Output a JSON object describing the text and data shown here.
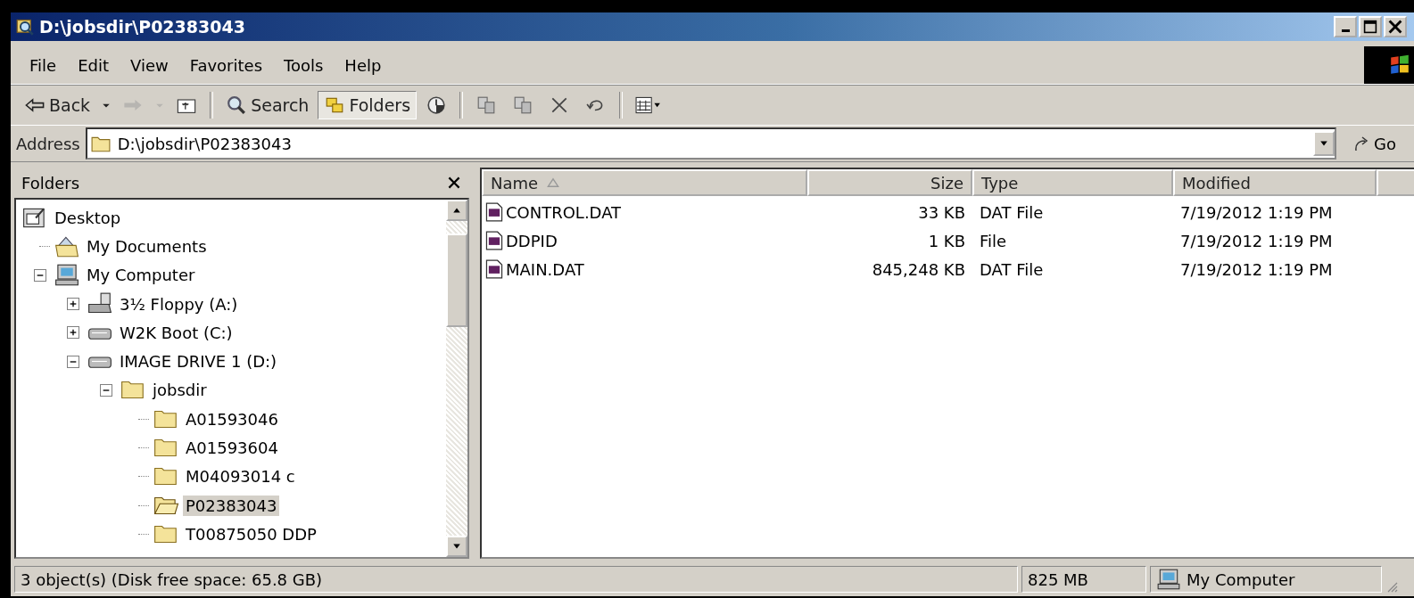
{
  "window": {
    "title": "D:\\jobsdir\\P02383043"
  },
  "menu": [
    "File",
    "Edit",
    "View",
    "Favorites",
    "Tools",
    "Help"
  ],
  "toolbar": [
    {
      "kind": "back",
      "label": "Back",
      "disabled": false,
      "on": false
    },
    {
      "kind": "dropdown",
      "disabled": false,
      "on": false
    },
    {
      "kind": "forward",
      "disabled": true,
      "on": false
    },
    {
      "kind": "dropdown",
      "disabled": true,
      "on": false
    },
    {
      "kind": "up",
      "disabled": false,
      "on": false
    },
    {
      "kind": "separator"
    },
    {
      "kind": "search",
      "label": "Search",
      "disabled": false,
      "on": false
    },
    {
      "kind": "folders",
      "label": "Folders",
      "disabled": false,
      "on": true
    },
    {
      "kind": "history",
      "disabled": false,
      "on": false
    },
    {
      "kind": "separator"
    },
    {
      "kind": "move",
      "disabled": false,
      "on": false
    },
    {
      "kind": "copy",
      "disabled": false,
      "on": false
    },
    {
      "kind": "delete",
      "disabled": false,
      "on": false
    },
    {
      "kind": "undo",
      "disabled": false,
      "on": false
    },
    {
      "kind": "separator"
    },
    {
      "kind": "views",
      "disabled": false,
      "on": false
    }
  ],
  "address": {
    "label": "Address",
    "value": "D:\\jobsdir\\P02383043",
    "go": "Go"
  },
  "folders_pane": {
    "title": "Folders"
  },
  "tree": [
    {
      "kind": "desktop",
      "label": "Desktop",
      "selected": false,
      "children": [
        {
          "kind": "documents",
          "label": "My Documents",
          "selected": false
        },
        {
          "kind": "computer",
          "label": "My Computer",
          "selected": false,
          "expanded": true,
          "children": [
            {
              "kind": "floppy",
              "label": "3½ Floppy (A:)",
              "selected": false,
              "expanded": false
            },
            {
              "kind": "drive",
              "label": "W2K Boot (C:)",
              "selected": false,
              "expanded": false
            },
            {
              "kind": "drive",
              "label": "IMAGE DRIVE 1 (D:)",
              "selected": false,
              "expanded": true,
              "children": [
                {
                  "kind": "folder",
                  "label": "jobsdir",
                  "selected": false,
                  "expanded": true,
                  "children": [
                    {
                      "kind": "folder",
                      "label": "A01593046",
                      "selected": false
                    },
                    {
                      "kind": "folder",
                      "label": "A01593604",
                      "selected": false
                    },
                    {
                      "kind": "folder",
                      "label": "M04093014 c",
                      "selected": false
                    },
                    {
                      "kind": "folder",
                      "label": "P02383043",
                      "selected": true
                    },
                    {
                      "kind": "folder",
                      "label": "T00875050 DDP",
                      "selected": false
                    }
                  ]
                }
              ]
            }
          ]
        }
      ]
    }
  ],
  "columns": [
    {
      "label": "Name",
      "sorted": true
    },
    {
      "label": "Size",
      "sorted": false
    },
    {
      "label": "Type",
      "sorted": false
    },
    {
      "label": "Modified",
      "sorted": false
    }
  ],
  "rows": [
    {
      "name": "CONTROL.DAT",
      "size": "33 KB",
      "type": "DAT File",
      "modified": "7/19/2012 1:19 PM"
    },
    {
      "name": "DDPID",
      "size": "1 KB",
      "type": "File",
      "modified": "7/19/2012 1:19 PM"
    },
    {
      "name": "MAIN.DAT",
      "size": "845,248 KB",
      "type": "DAT File",
      "modified": "7/19/2012 1:19 PM"
    }
  ],
  "status_bar": {
    "text": "3 object(s) (Disk free space: 65.8 GB)",
    "size": "825 MB",
    "zone": "My Computer"
  }
}
